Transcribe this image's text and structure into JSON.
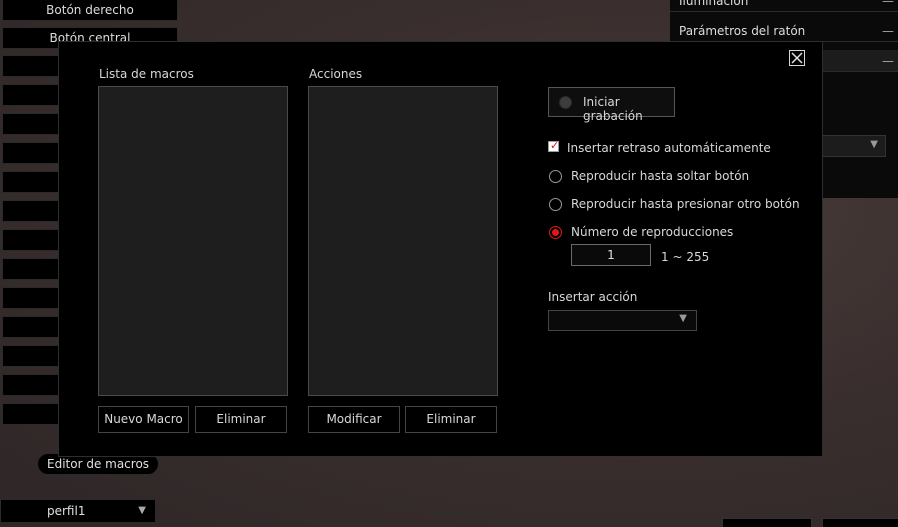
{
  "background": {
    "left_buttons": [
      "Botón derecho",
      "Botón central",
      "",
      "",
      "",
      "",
      "",
      "",
      "",
      "",
      "",
      "",
      "",
      "",
      ""
    ],
    "right_panel": {
      "rows": [
        {
          "label": "Iluminación",
          "indicator": "—"
        },
        {
          "label": "Parámetros del ratón",
          "indicator": "—"
        },
        {
          "label": "",
          "indicator": "—"
        }
      ],
      "select_arrow": "▼"
    },
    "macro_editor_tab": "Editor de macros",
    "profile": {
      "value": "perfil1",
      "arrow": "▼"
    }
  },
  "modal": {
    "close_icon": "close-icon",
    "macro_list": {
      "label": "Lista de macros",
      "items": []
    },
    "actions_list": {
      "label": "Acciones",
      "items": []
    },
    "buttons": {
      "new_macro": "Nuevo Macro",
      "delete_macro": "Eliminar",
      "modify_action": "Modificar",
      "delete_action": "Eliminar"
    },
    "record": {
      "label": "Iniciar grabación",
      "icon": "record-icon"
    },
    "auto_delay": {
      "label": "Insertar retraso automáticamente",
      "checked": true
    },
    "playback_options": [
      {
        "label": "Reproducir hasta soltar botón",
        "selected": false
      },
      {
        "label": "Reproducir hasta presionar otro botón",
        "selected": false
      },
      {
        "label": "Número de reproducciones",
        "selected": true
      }
    ],
    "repeat_count": {
      "value": "1",
      "range": "1 ~ 255"
    },
    "insert_action": {
      "label": "Insertar acción",
      "value": "",
      "arrow": "▼"
    },
    "colors": {
      "accent": "#e01818",
      "panel": "#000000",
      "list_bg": "#1e1e1e"
    }
  }
}
